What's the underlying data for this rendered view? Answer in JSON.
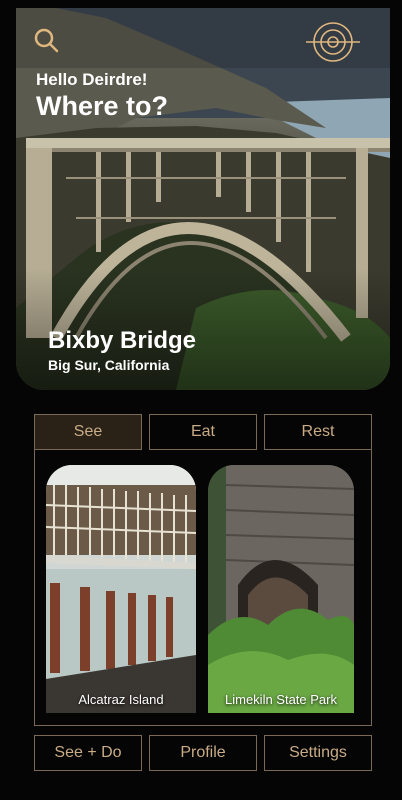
{
  "header": {
    "greeting": "Hello Deirdre!",
    "headline": "Where to?",
    "search_icon": "search-icon",
    "logo_icon": "target-compass-logo"
  },
  "hero": {
    "title": "Bixby Bridge",
    "subtitle": "Big Sur, California"
  },
  "tabs": [
    {
      "label": "See",
      "active": true
    },
    {
      "label": "Eat",
      "active": false
    },
    {
      "label": "Rest",
      "active": false
    }
  ],
  "cards": [
    {
      "label": "Alcatraz Island"
    },
    {
      "label": "Limekiln State Park"
    }
  ],
  "bottom_nav": [
    {
      "label": "See + Do"
    },
    {
      "label": "Profile"
    },
    {
      "label": "Settings"
    }
  ],
  "colors": {
    "accent": "#c9ac86",
    "border": "#7a6a55",
    "active_tab_bg": "#2b2217",
    "background": "#050505"
  }
}
